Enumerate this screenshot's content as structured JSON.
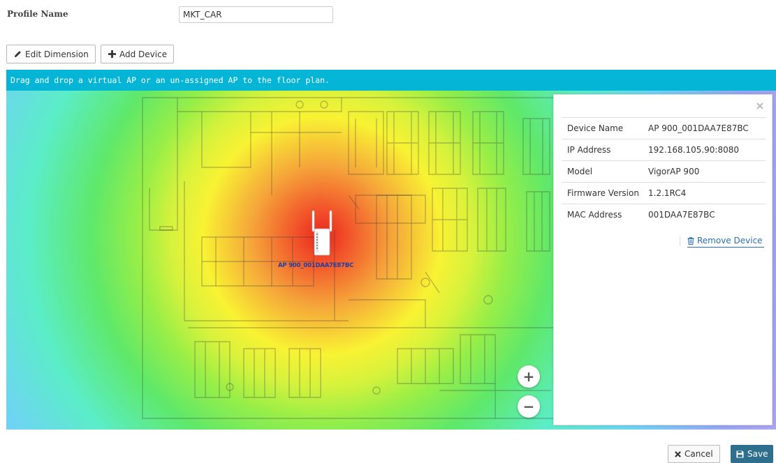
{
  "profile": {
    "label": "Profile Name",
    "value": "MKT_CAR"
  },
  "toolbar": {
    "edit_label": "Edit Dimension",
    "add_label": "Add Device"
  },
  "banner": {
    "text": "Drag and drop a virtual AP or an un-assigned AP to the floor plan."
  },
  "map": {
    "ap_label": "AP 900_001DAA7E87BC",
    "zoom_in": "+",
    "zoom_out": "−",
    "heatmap_center_color": "#e8251f",
    "heatmap_edge_color": "#b7a5ef"
  },
  "device_panel": {
    "rows": [
      {
        "key": "Device Name",
        "value": "AP 900_001DAA7E87BC"
      },
      {
        "key": "IP Address",
        "value": "192.168.105.90:8080"
      },
      {
        "key": "Model",
        "value": "VigorAP 900"
      },
      {
        "key": "Firmware Version",
        "value": "1.2.1RC4"
      },
      {
        "key": "MAC Address",
        "value": "001DAA7E87BC"
      }
    ],
    "remove_label": "Remove Device"
  },
  "footer": {
    "cancel_label": "Cancel",
    "save_label": "Save"
  },
  "colors": {
    "banner_bg": "#04b5d5",
    "save_bg": "#2f6f8e",
    "link": "#2a6fb3"
  }
}
